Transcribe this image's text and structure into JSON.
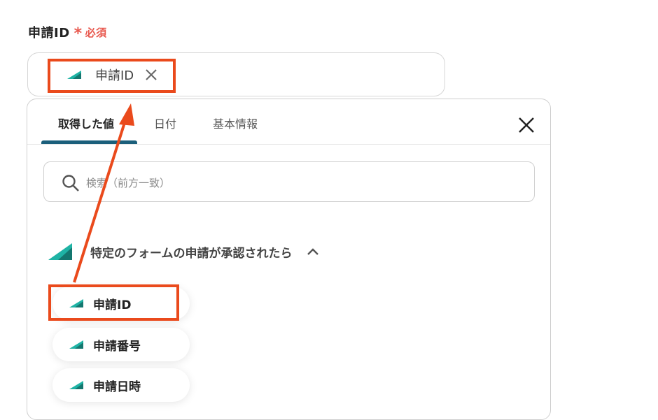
{
  "field": {
    "label": "申請ID",
    "required_mark": "*",
    "required_text": "必須",
    "chip_label": "申請ID"
  },
  "panel": {
    "tabs": [
      "取得した値",
      "日付",
      "基本情報"
    ],
    "active_tab": "取得した値",
    "search_placeholder": "検索（前方一致）",
    "section_title": "特定のフォームの申請が承認されたら",
    "items": [
      "申請ID",
      "申請番号",
      "申請日時"
    ]
  },
  "colors": {
    "accent": "#1b5f7b",
    "required": "#e8584e",
    "highlight": "#ea4a1c",
    "logo_dark": "#14776f",
    "logo_light": "#1fb3a5"
  }
}
